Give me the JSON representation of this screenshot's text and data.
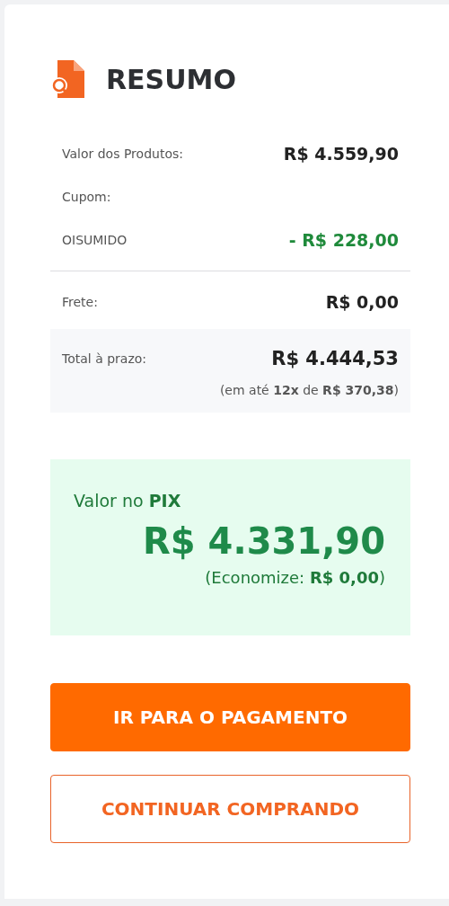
{
  "summary": {
    "title": "RESUMO",
    "rows": [
      {
        "kind": "value",
        "label": "Valor dos Produtos:",
        "value": "R$ 4.559,90"
      },
      {
        "kind": "label",
        "label": "Cupom:"
      },
      {
        "kind": "discount",
        "label": "OISUMIDO",
        "value": "- R$ 228,00"
      },
      {
        "kind": "divider"
      },
      {
        "kind": "value",
        "label": "Frete:",
        "value": "R$ 0,00"
      }
    ],
    "total": {
      "label": "Total à prazo:",
      "value": "R$ 4.444,53",
      "installments": "(em até **12x** de **R$ 370,38**)"
    },
    "pix": {
      "label": "Valor no **PIX**",
      "value": "R$ 4.331,90",
      "savings": "(Economize: **R$ 0,00**)"
    },
    "buttons": [
      {
        "kind": "primary",
        "label": "IR PARA O PAGAMENTO"
      },
      {
        "kind": "outline",
        "label": "CONTINUAR COMPRANDO"
      }
    ]
  }
}
